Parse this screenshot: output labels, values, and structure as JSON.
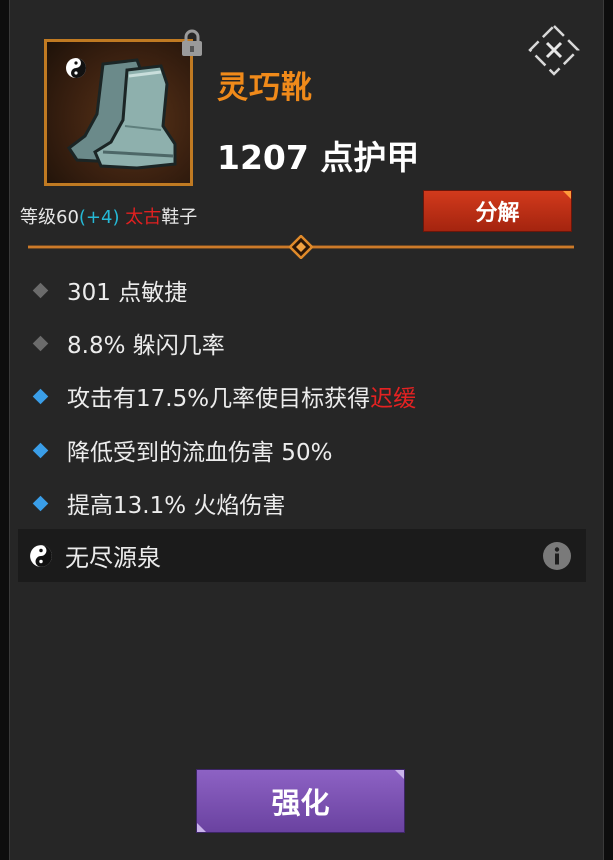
{
  "item": {
    "name": "灵巧靴",
    "armor": "1207 点护甲",
    "level_label": "等级60",
    "level_bonus": "(+4)",
    "tier": "太古",
    "slot": "鞋子"
  },
  "actions": {
    "decompose_label": "分解",
    "enhance_label": "强化"
  },
  "stats": [
    {
      "text": "301 点敏捷",
      "bullet": "gray"
    },
    {
      "text": "8.8% 躲闪几率",
      "bullet": "gray"
    },
    {
      "text": "攻击有17.5%几率使目标获得",
      "highlight": "迟缓",
      "bullet": "blue"
    },
    {
      "text": "降低受到的流血伤害 50%",
      "bullet": "blue"
    },
    {
      "text": "提高13.1% 火焰伤害",
      "bullet": "blue"
    }
  ],
  "set": {
    "name": "无尽源泉"
  },
  "colors": {
    "item_name": "#f08a1a",
    "bonus": "#25b9d6",
    "tier": "#e02020",
    "decompose": "#c4301a",
    "enhance": "#7c53b4",
    "primary_bullet": "#6b6b6b",
    "secondary_bullet": "#3a9ee8"
  },
  "icons": {
    "item": "boots-icon",
    "lock": "lock-icon",
    "close": "close-icon",
    "set": "yin-yang-icon",
    "info": "info-icon"
  }
}
